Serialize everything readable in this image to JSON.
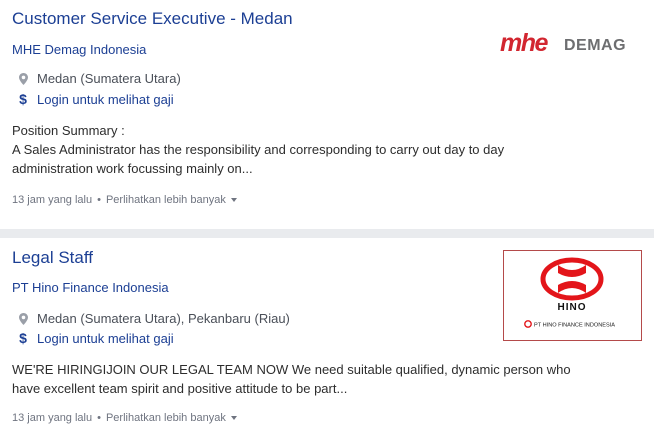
{
  "jobs": [
    {
      "title": "Customer Service Executive - Medan",
      "company": "MHE Demag Indonesia",
      "location": "Medan (Sumatera Utara)",
      "salary": "Login untuk melihat gaji",
      "description_lines": [
        "Position Summary :",
        "A Sales Administrator has the responsibility and corresponding to carry out day to day",
        "administration work focussing mainly on..."
      ],
      "posted": "13 jam yang lalu",
      "more": "Perlihatkan lebih banyak",
      "logo_text": {
        "mark": "mhe",
        "name": "DEMAG"
      }
    },
    {
      "title": "Legal Staff",
      "company": "PT Hino Finance Indonesia",
      "location": "Medan (Sumatera Utara), Pekanbaru (Riau)",
      "salary": "Login untuk melihat gaji",
      "description_lines": [
        "WE'RE HIRINGIJOIN OUR LEGAL TEAM NOW We need suitable qualified, dynamic person who",
        "have excellent team spirit and positive attitude to be part..."
      ],
      "posted": "13 jam yang lalu",
      "more": "Perlihatkan lebih banyak",
      "logo_text": {
        "name": "HINO",
        "sub": "PT HINO FINANCE INDONESIA"
      }
    }
  ],
  "separator_glyph": "•",
  "icons": {
    "location": "map-pin-icon",
    "salary": "dollar-icon",
    "caret": "caret-down-icon"
  },
  "colors": {
    "link": "#1c3f94",
    "mhe_red": "#d22630",
    "demag_gray": "#6d6e70",
    "hino_red": "#e3151a"
  }
}
